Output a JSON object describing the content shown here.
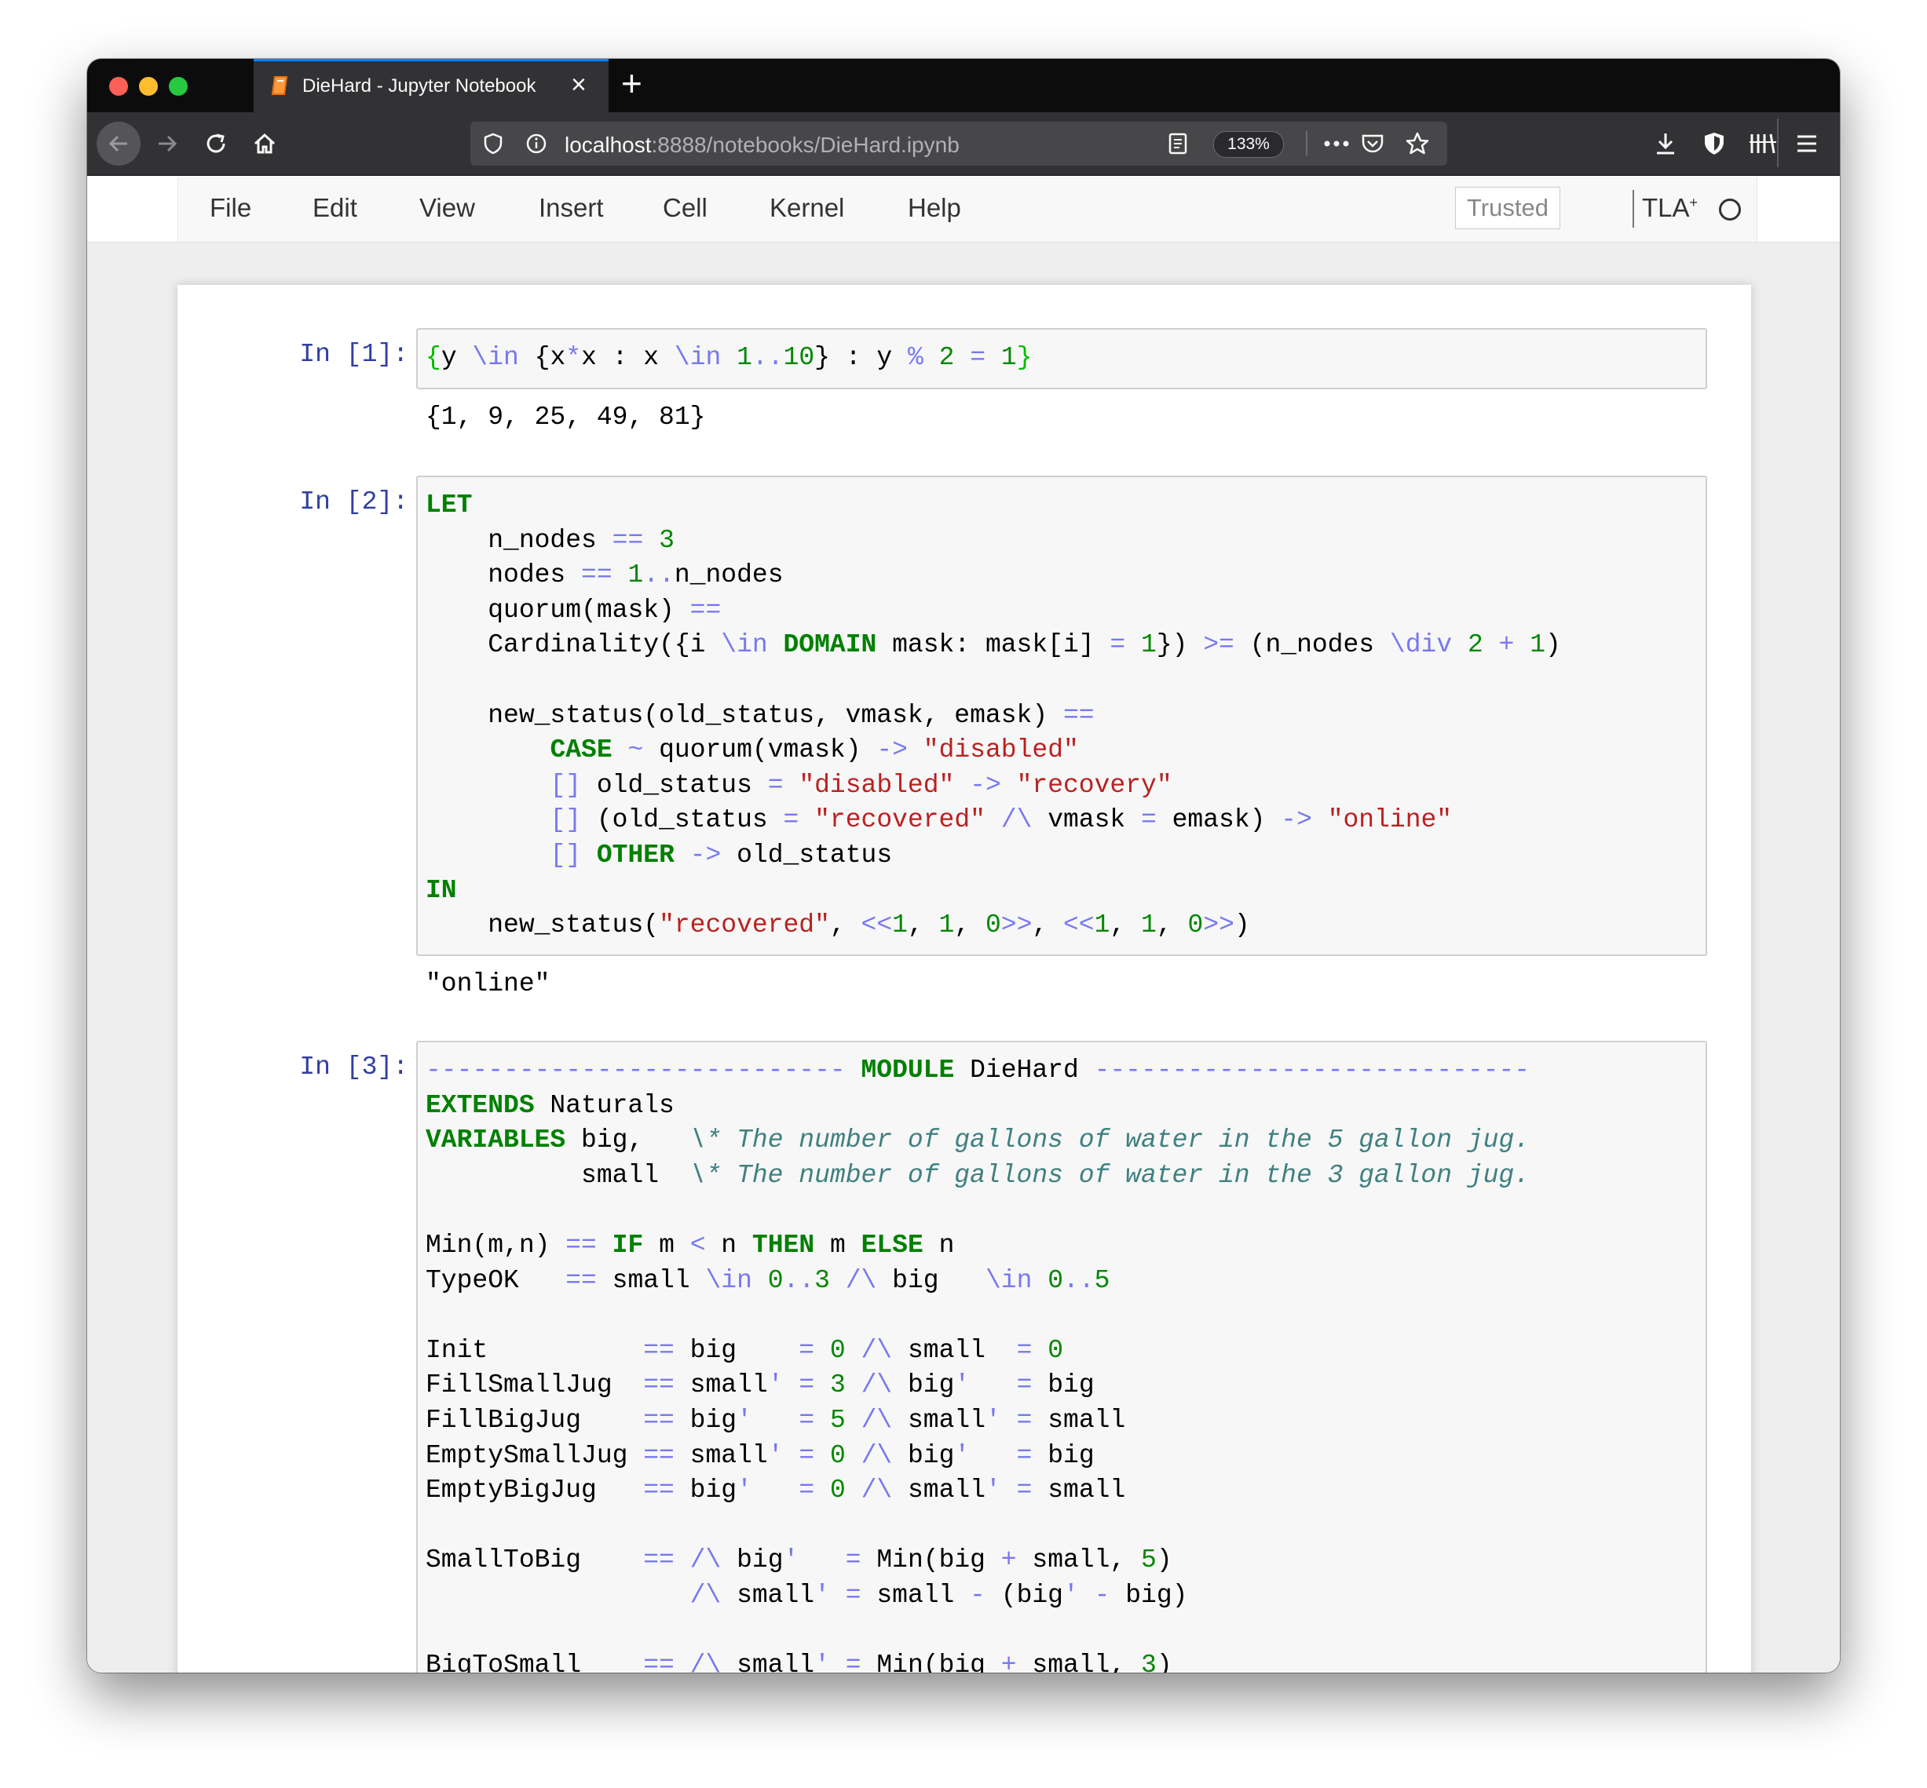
{
  "browser": {
    "tab_title": "DieHard - Jupyter Notebook",
    "new_tab_label": "+",
    "url_host": "localhost",
    "url_rest": ":8888/notebooks/DieHard.ipynb",
    "zoom": "133%"
  },
  "menubar": {
    "items": [
      "File",
      "Edit",
      "View",
      "Insert",
      "Cell",
      "Kernel",
      "Help"
    ],
    "trusted_label": "Trusted",
    "kernel_name": "TLA",
    "kernel_sup": "+"
  },
  "cells": [
    {
      "prompt": "In [1]:",
      "code": "{y \\in {x*x : x \\in 1..10} : y % 2 = 1}",
      "output": "{1, 9, 25, 49, 81}"
    },
    {
      "prompt": "In [2]:",
      "code": "LET\n    n_nodes == 3\n    nodes == 1..n_nodes\n    quorum(mask) ==\n    Cardinality({i \\in DOMAIN mask: mask[i] = 1}) >= (n_nodes \\div 2 + 1)\n\n    new_status(old_status, vmask, emask) ==\n        CASE ~ quorum(vmask) -> \"disabled\"\n        [] old_status = \"disabled\" -> \"recovery\"\n        [] (old_status = \"recovered\" /\\ vmask = emask) -> \"online\"\n        [] OTHER -> old_status\nIN\n    new_status(\"recovered\", <<1, 1, 0>>, <<1, 1, 0>>)",
      "output": "\"online\""
    },
    {
      "prompt": "In [3]:",
      "code": "--------------------------- MODULE DieHard ----------------------------\nEXTENDS Naturals\nVARIABLES big,   \\* The number of gallons of water in the 5 gallon jug.\n          small  \\* The number of gallons of water in the 3 gallon jug.\n\nMin(m,n) == IF m < n THEN m ELSE n\nTypeOK   == small \\in 0..3 /\\ big   \\in 0..5\n\nInit          == big    = 0 /\\ small  = 0\nFillSmallJug  == small' = 3 /\\ big'   = big\nFillBigJug    == big'   = 5 /\\ small' = small\nEmptySmallJug == small' = 0 /\\ big'   = big\nEmptyBigJug   == big'   = 0 /\\ small' = small\n\nSmallToBig    == /\\ big'   = Min(big + small, 5)\n                 /\\ small' = small - (big' - big)\n\nBigToSmall    == /\\ small' = Min(big + small, 3)"
    }
  ]
}
